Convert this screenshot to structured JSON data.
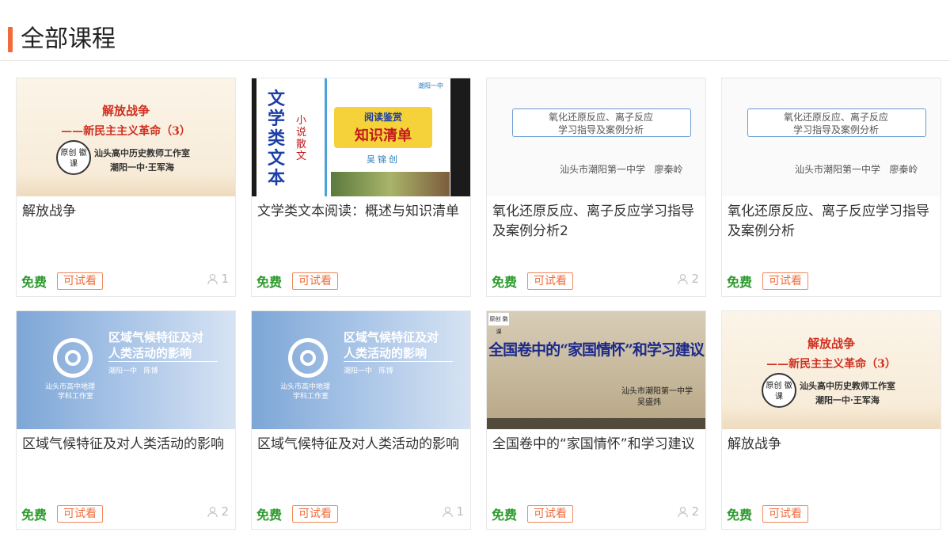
{
  "section_title": "全部课程",
  "labels": {
    "price": "免费",
    "trial": "可试看"
  },
  "colors": {
    "accent": "#f26b3a",
    "free_green": "#2b9a2b"
  },
  "courses": [
    {
      "title": "解放战争",
      "students": "1",
      "thumb": {
        "style": "beige",
        "line1": "解放战争",
        "line2": "——新民主主义革命（3）",
        "line3": "汕头高中历史教师工作室",
        "line4": "潮阳一中·王军海",
        "logo": "原创 徽课"
      }
    },
    {
      "title": "文学类文本阅读：概述与知识清单",
      "students": "",
      "thumb": {
        "style": "dark",
        "line1": "文学类文本",
        "line2": "小说 散文",
        "line3": "阅读鉴赏",
        "line4": "知识清单",
        "line5": "吴锦创",
        "logo": "潮阳一中"
      }
    },
    {
      "title": "氧化还原反应、离子反应学习指导及案例分析2",
      "students": "2",
      "thumb": {
        "style": "white",
        "line1": "氧化还原反应、离子反应",
        "line2": "学习指导及案例分析",
        "line3": "汕头市潮阳第一中学   廖秦岭"
      }
    },
    {
      "title": "氧化还原反应、离子反应学习指导及案例分析",
      "students": "",
      "thumb": {
        "style": "white",
        "line1": "氧化还原反应、离子反应",
        "line2": "学习指导及案例分析",
        "line3": "汕头市潮阳第一中学   廖秦岭"
      }
    },
    {
      "title": "区域气候特征及对人类活动的影响",
      "students": "2",
      "thumb": {
        "style": "blue",
        "line1": "区域气候特征及对",
        "line2": "人类活动的影响",
        "line3": "潮阳一中   陈博",
        "line4": "汕头市高中地理",
        "line5": "学科工作室"
      }
    },
    {
      "title": "区域气候特征及对人类活动的影响",
      "students": "1",
      "thumb": {
        "style": "blue",
        "line1": "区域气候特征及对",
        "line2": "人类活动的影响",
        "line3": "潮阳一中   陈博",
        "line4": "汕头市高中地理",
        "line5": "学科工作室"
      }
    },
    {
      "title": "全国卷中的“家国情怀”和学习建议",
      "students": "2",
      "thumb": {
        "style": "wall",
        "line1": "全国卷中的“家国情怀”和学习建议",
        "line2": "汕头市潮阳第一中学",
        "line3": "吴盛炜",
        "logo": "原创 徽课"
      }
    },
    {
      "title": "解放战争",
      "students": "",
      "thumb": {
        "style": "beige",
        "line1": "解放战争",
        "line2": "——新民主主义革命（3）",
        "line3": "汕头高中历史教师工作室",
        "line4": "潮阳一中·王军海",
        "logo": "原创 徽课"
      }
    }
  ]
}
